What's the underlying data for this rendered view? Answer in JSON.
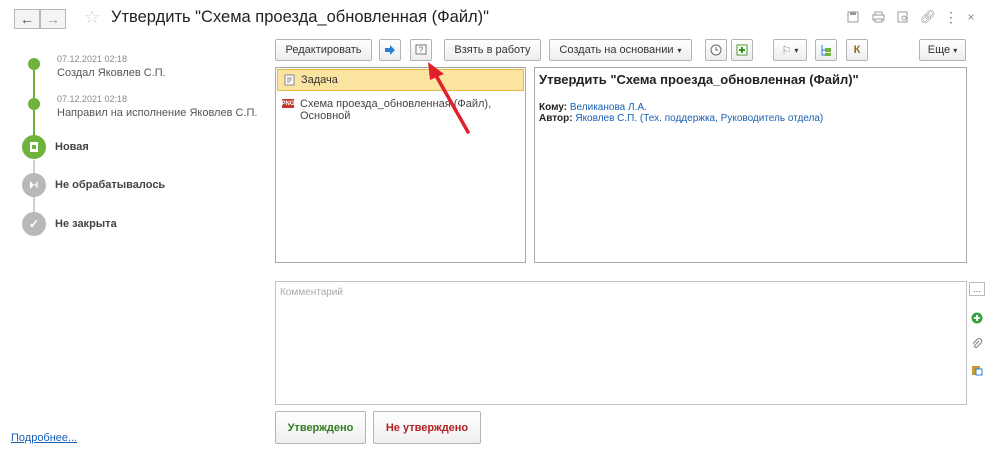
{
  "window": {
    "title": "Утвердить \"Схема проезда_обновленная (Файл)\"",
    "icons": [
      "back-arrow-icon",
      "forward-arrow-icon",
      "star-icon",
      "save-icon",
      "print-icon",
      "preview-icon",
      "link-icon",
      "more-vertical-icon",
      "close-icon"
    ]
  },
  "history": [
    {
      "date": "07.12.2021 02:18",
      "text": "Создал Яковлев С.П."
    },
    {
      "date": "07.12.2021 02:18",
      "text": "Направил на исполнение Яковлев С.П."
    }
  ],
  "statuses": [
    {
      "label": "Новая",
      "icon": "task-icon",
      "color": "#6fb23c"
    },
    {
      "label": "Не обрабатывалось",
      "icon": "hourglass-icon",
      "color": "#b8b8b8"
    },
    {
      "label": "Не закрыта",
      "icon": "check-icon",
      "color": "#b8b8b8"
    }
  ],
  "more_link": "Подробнее...",
  "toolbar": {
    "edit": "Редактировать",
    "take_to_work": "Взять в работу",
    "create_based_on": "Создать на основании",
    "more": "Еще",
    "k_label": "К"
  },
  "tree": {
    "task": "Задача",
    "file_line1": "Схема проезда_обновленная (Файл),",
    "file_line2": "Основной",
    "file_badge": "PNG"
  },
  "details": {
    "title": "Утвердить \"Схема проезда_обновленная (Файл)\"",
    "to_label": "Кому:",
    "to_value": "Великанова Л.А.",
    "author_label": "Автор:",
    "author_value": "Яковлев С.П. (Тех. поддержка, Руководитель отдела)"
  },
  "comment": {
    "placeholder": "Комментарий",
    "more": "..."
  },
  "buttons": {
    "approved": "Утверждено",
    "not_approved": "Не утверждено"
  },
  "colors": {
    "approved_text": "#2e7d1e",
    "not_approved_text": "#b22222",
    "selected_row": "#fbe3a0",
    "accent_green": "#6fb23c",
    "link": "#1a5fb4",
    "arrow": "#e0202a"
  }
}
